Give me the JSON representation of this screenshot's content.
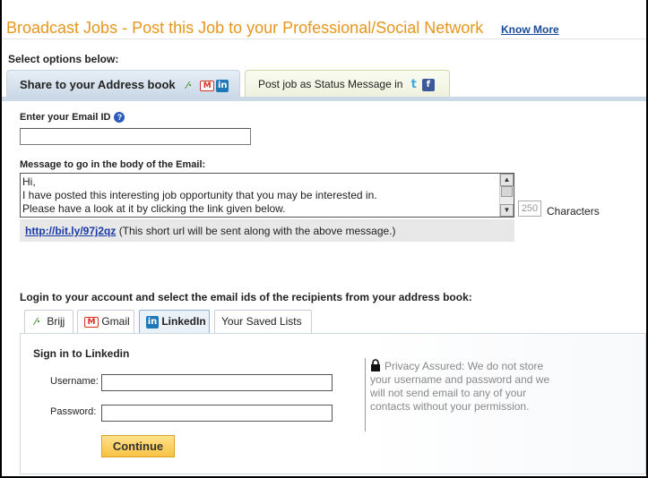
{
  "header": {
    "title": "Broadcast Jobs - Post this Job to your Professional/Social Network",
    "know_more": "Know More"
  },
  "select_label": "Select options below:",
  "share_tabs": [
    {
      "label": "Share to your Address book",
      "icons": [
        "brijj-icon",
        "gmail-icon",
        "linkedin-icon"
      ],
      "active": true
    },
    {
      "label": "Post job as Status Message in",
      "icons": [
        "twitter-icon",
        "facebook-icon"
      ],
      "active": false
    }
  ],
  "form": {
    "email_label": "Enter your Email ID",
    "email_value": "",
    "message_label": "Message to go in the body of the Email:",
    "message_text": "Hi,\nI have posted this interesting job opportunity that you may be interested in.\nPlease have a look at it by clicking the link given below.",
    "char_count": "250",
    "char_label": "Characters",
    "short_url": "http://bit.ly/97j2qz",
    "short_url_note": "(This short url will be sent along with the above message.)"
  },
  "login_label": "Login to your account and select the email ids of the recipients from your address book:",
  "address_tabs": [
    {
      "label": "Brijj",
      "icon": "brijj-icon",
      "active": false
    },
    {
      "label": "Gmail",
      "icon": "gmail-icon",
      "active": false
    },
    {
      "label": "LinkedIn",
      "icon": "linkedin-icon",
      "active": true
    },
    {
      "label": "Your Saved Lists",
      "icon": "",
      "active": false
    }
  ],
  "signin": {
    "title": "Sign in to Linkedin",
    "username_label": "Username:",
    "username_value": "",
    "password_label": "Password:",
    "password_value": "",
    "continue_label": "Continue",
    "privacy_text": "Privacy Assured: We do not store your username and password and we will not send email to any of your contacts without your permission."
  },
  "colors": {
    "title": "#e8961e",
    "link": "#1a4a9a",
    "tab_active": "#cad8e6",
    "button": "#f7c244"
  }
}
